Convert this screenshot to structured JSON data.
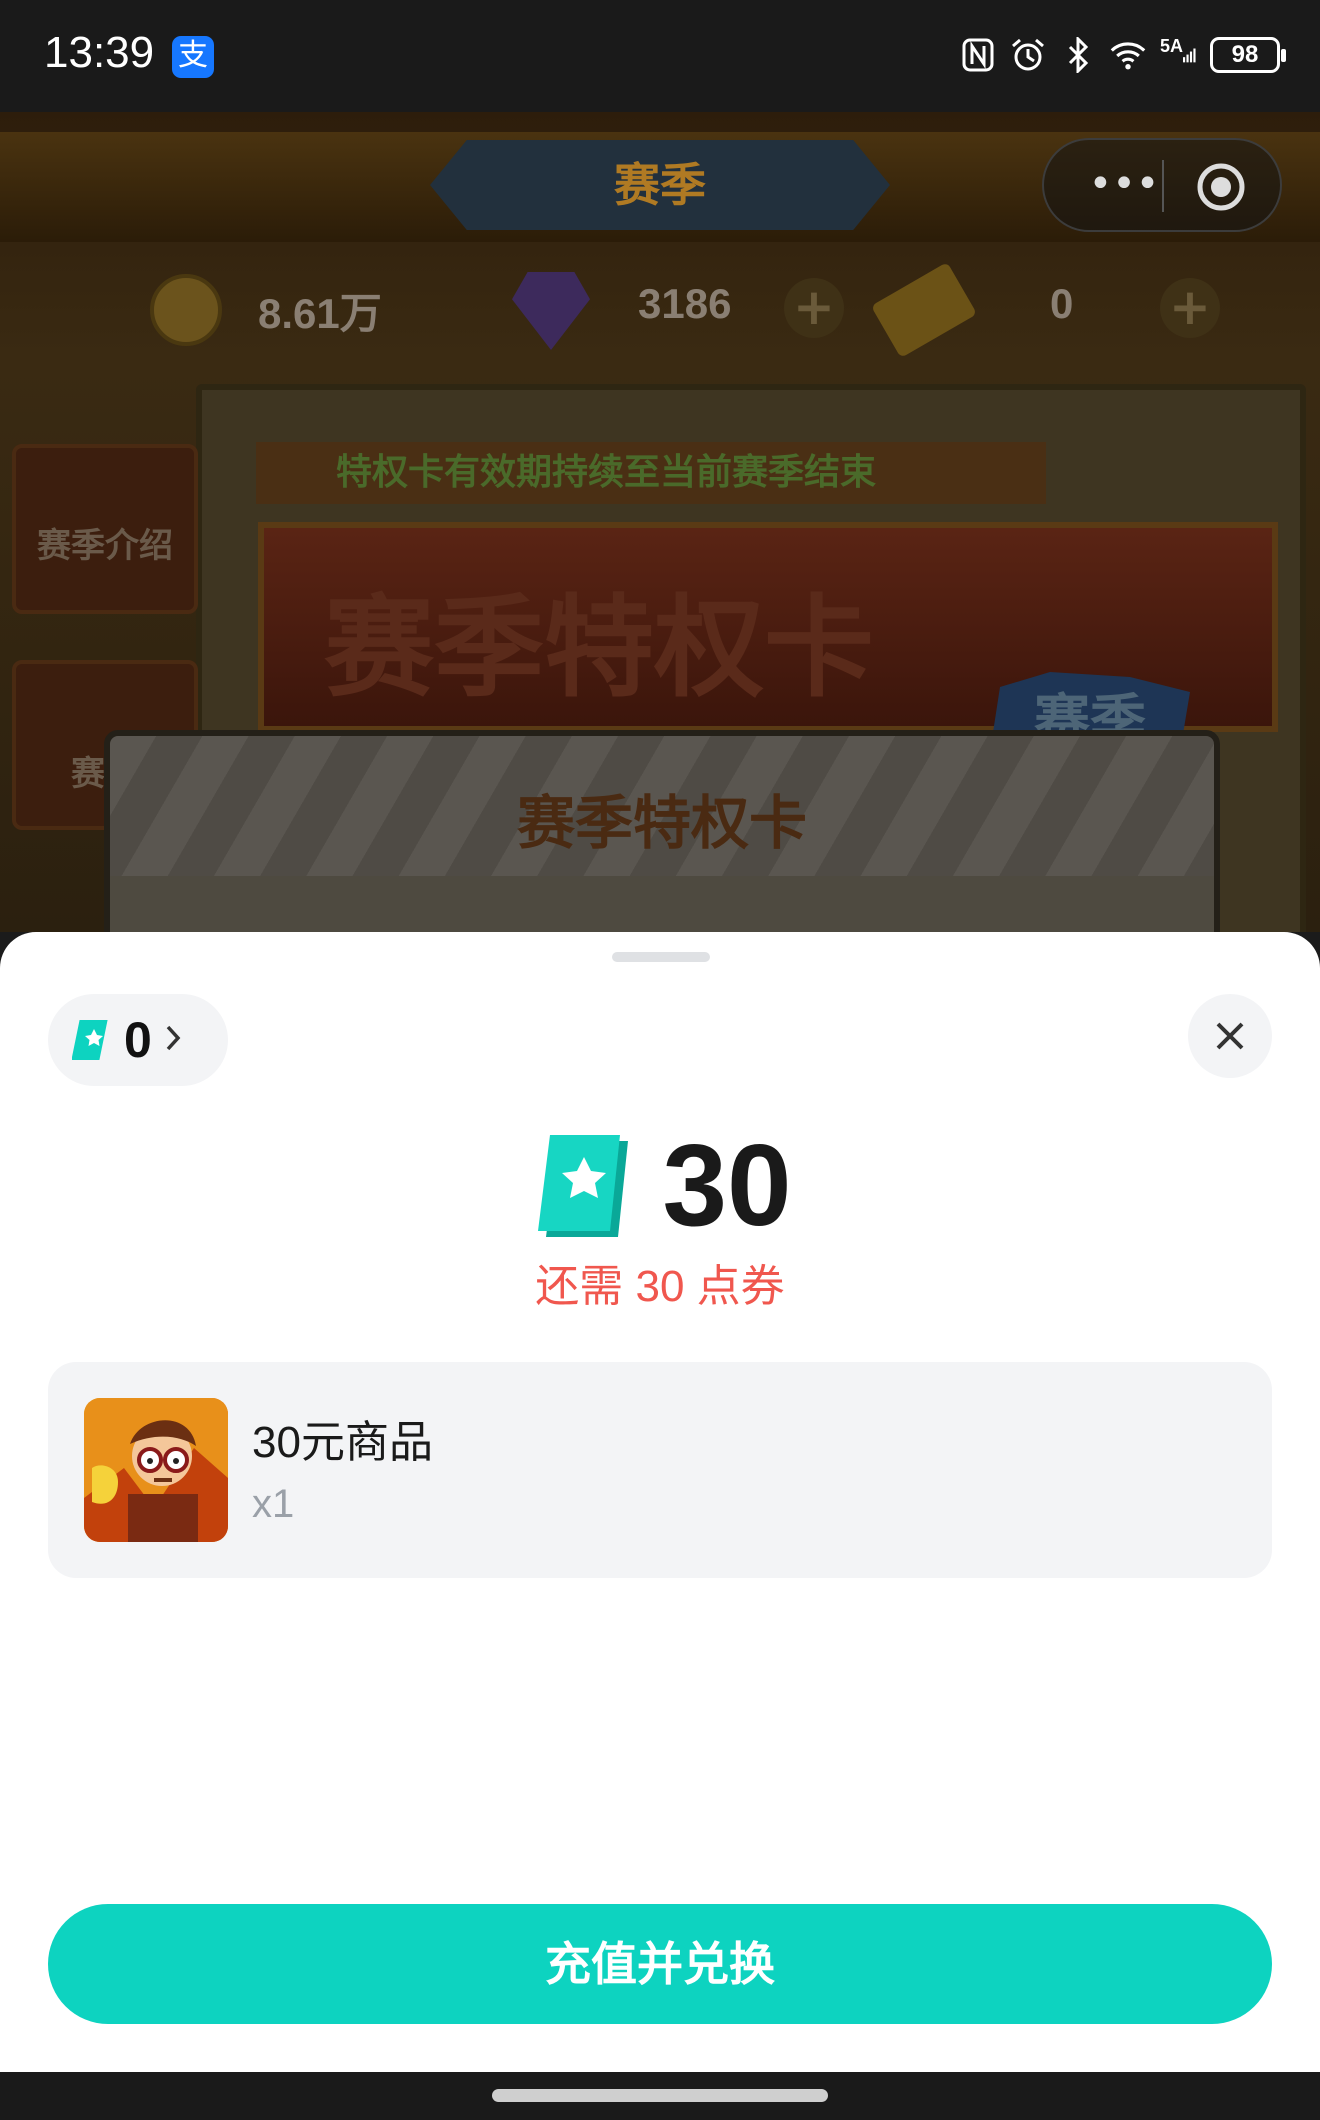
{
  "status_bar": {
    "time": "13:39",
    "alipay_icon": "支",
    "network": "5A",
    "battery": "98"
  },
  "game": {
    "title": "赛季",
    "capsule_menu": "•••",
    "resources": {
      "coins": "8.61万",
      "gems": "3186",
      "tickets": "0",
      "plus": "+"
    },
    "side_tabs": [
      "赛季介绍",
      "赛季"
    ],
    "tip": "特权卡有效期持续至当前赛季结束",
    "banner_title": "赛季特权卡",
    "badge": "赛季",
    "dialog_title": "赛季特权卡"
  },
  "sheet": {
    "balance": "0",
    "price": "30",
    "need_text": "还需 30 点券",
    "product": {
      "name": "30元商品",
      "quantity": "x1"
    },
    "cta_label": "充值并兑换"
  },
  "colors": {
    "accent": "#0dd3c0",
    "warning": "#f0574e",
    "card_bg": "#f3f4f6"
  },
  "icons": [
    "alipay-icon",
    "nfc-icon",
    "alarm-icon",
    "bluetooth-icon",
    "wifi-icon",
    "signal-icon",
    "battery-icon",
    "more-icon",
    "target-icon",
    "coin-icon",
    "gem-icon",
    "ticket-icon",
    "coupon-icon",
    "chevron-right-icon",
    "close-icon"
  ]
}
